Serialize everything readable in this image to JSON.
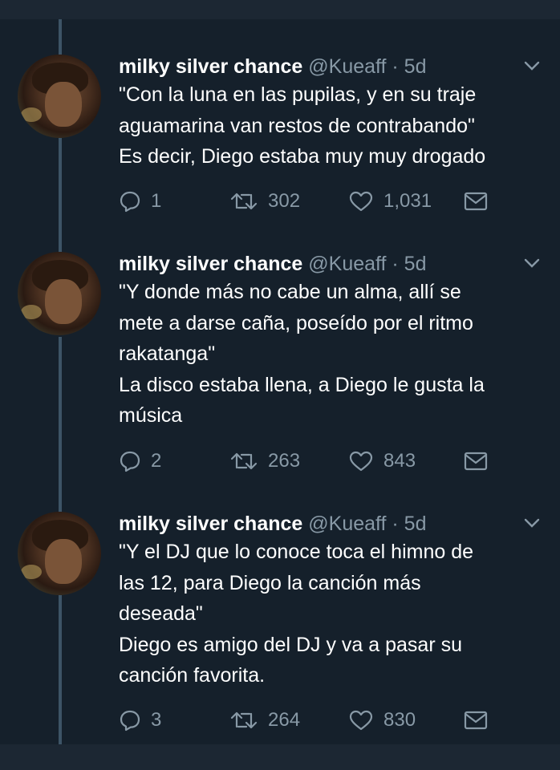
{
  "colors": {
    "background": "#15202b",
    "text": "#ffffff",
    "muted": "#8899a6",
    "thread_line": "#3d5466"
  },
  "tweets": [
    {
      "name": "milky silver chance",
      "handle": "@Kueaff · 5d",
      "lines": [
        "\"Con la luna en las pupilas, y en su traje",
        "aguamarina van restos de contrabando\"",
        "Es decir, Diego estaba muy muy drogado"
      ],
      "replies": "1",
      "retweets": "302",
      "likes": "1,031"
    },
    {
      "name": "milky silver chance",
      "handle": "@Kueaff · 5d",
      "lines": [
        "\"Y donde más no cabe un alma, allí se",
        "mete a darse caña, poseído por el ritmo",
        "rakatanga\"",
        "La disco estaba llena, a Diego le gusta la",
        "música"
      ],
      "replies": "2",
      "retweets": "263",
      "likes": "843"
    },
    {
      "name": "milky silver chance",
      "handle": "@Kueaff · 5d",
      "lines": [
        "\"Y el DJ que lo conoce toca el himno de",
        "las 12, para Diego la canción más",
        "deseada\"",
        "Diego es amigo del DJ y va a pasar su",
        "canción favorita."
      ],
      "replies": "3",
      "retweets": "264",
      "likes": "830"
    }
  ]
}
